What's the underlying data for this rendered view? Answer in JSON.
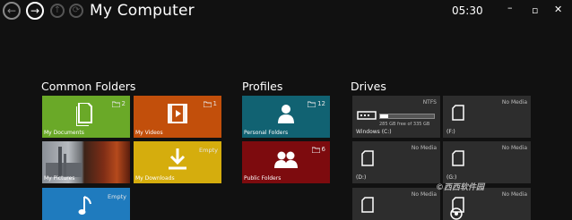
{
  "window": {
    "title": "My Computer",
    "clock": "05:30",
    "back_icon": "←",
    "forward_icon": "→",
    "up_icon": "↑",
    "refresh_icon": "⟳",
    "minimize_icon": "–",
    "maximize_icon": "▫",
    "close_icon": "✕"
  },
  "groups": {
    "common_folders": "Common Folders",
    "profiles": "Profiles",
    "drives": "Drives"
  },
  "tiles": {
    "documents": {
      "label": "My Documents",
      "count": "2",
      "color": "#6aa928",
      "icon": "documents-icon"
    },
    "videos": {
      "label": "My Videos",
      "count": "1",
      "color": "#c24f0b",
      "icon": "film-icon"
    },
    "pictures": {
      "label": "My Pictures",
      "color": "#4a4a4a",
      "icon": "photo-thumbnail"
    },
    "downloads": {
      "label": "My Downloads",
      "status": "Empty",
      "color": "#d5ad0d",
      "icon": "download-icon"
    },
    "music": {
      "status": "Empty",
      "color": "#1f7bbe",
      "icon": "music-note-icon"
    },
    "personal": {
      "label": "Personal Folders",
      "count": "12",
      "color": "#116272",
      "icon": "person-icon"
    },
    "public": {
      "label": "Public Folders",
      "count": "6",
      "color": "#7d0b0e",
      "icon": "people-icon"
    }
  },
  "drives": {
    "c": {
      "label": "Windows (C:)",
      "fs": "NTFS",
      "free_text": "285 GB free of 335 GB",
      "used_fraction": 0.15
    },
    "f": {
      "label": "(F:)",
      "status": "No Media"
    },
    "d": {
      "label": "(D:)",
      "status": "No Media"
    },
    "g": {
      "label": "(G:)",
      "status": "No Media"
    },
    "e": {
      "status": "No Media"
    },
    "h": {
      "status": "No Media"
    }
  },
  "watermark": "©西西软件园"
}
